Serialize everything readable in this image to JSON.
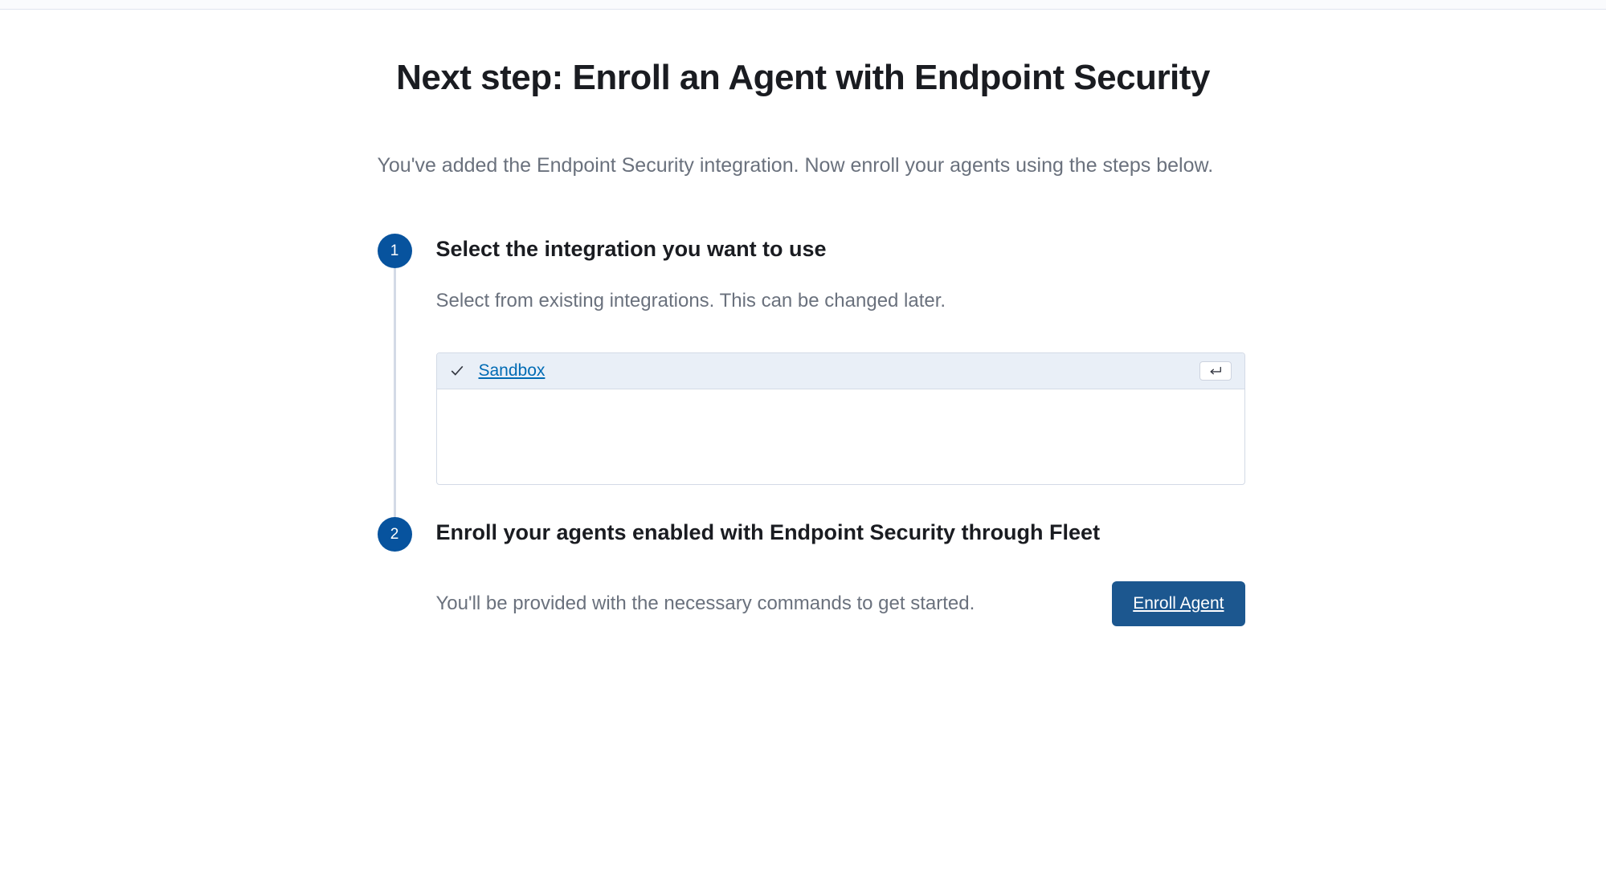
{
  "page": {
    "title": "Next step: Enroll an Agent with Endpoint Security",
    "subtitle": "You've added the Endpoint Security integration. Now enroll your agents using the steps below."
  },
  "steps": [
    {
      "number": "1",
      "title": "Select the integration you want to use",
      "description": "Select from existing integrations. This can be changed later.",
      "combobox": {
        "options": [
          {
            "label": "Sandbox",
            "selected": true
          }
        ]
      }
    },
    {
      "number": "2",
      "title": "Enroll your agents enabled with Endpoint Security through Fleet",
      "description": "You'll be provided with the necessary commands to get started.",
      "button_label": "Enroll Agent"
    }
  ]
}
